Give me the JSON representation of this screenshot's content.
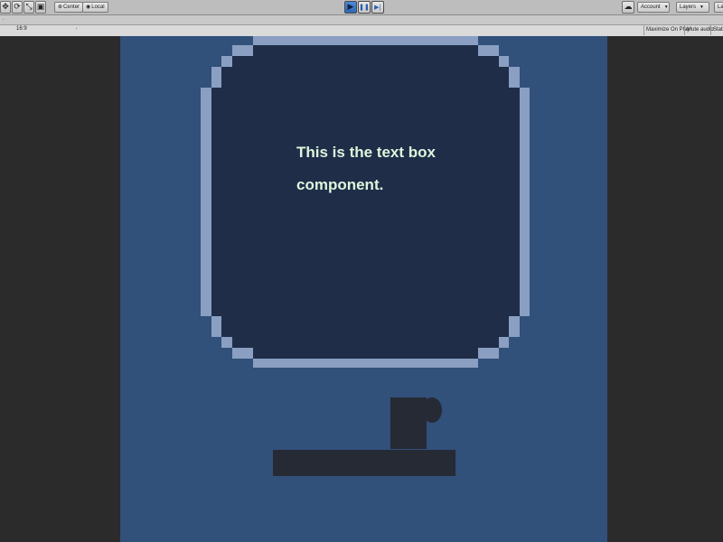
{
  "toolbar": {
    "transform_tools": [
      {
        "name": "move-tool",
        "glyph": "✥"
      },
      {
        "name": "rotate-tool",
        "glyph": "⟳"
      },
      {
        "name": "scale-tool",
        "glyph": "⤡"
      },
      {
        "name": "rect-tool",
        "glyph": "▣"
      }
    ],
    "pivot_label": "Center",
    "space_label": "Local",
    "playback": {
      "play": "▶",
      "pause": "❚❚",
      "step": "▶|"
    },
    "cloud_glyph": "☁",
    "account_label": "Account",
    "layers_label": "Layers",
    "layout_label": "La"
  },
  "game_view": {
    "display_ticks": ".",
    "aspect_label": "",
    "aspect_value": "16:9",
    "aspect_caret": "‹",
    "maximize_label": "Maximize On Play",
    "mute_label": "Mute audio",
    "stats_label": "Stats"
  },
  "scene": {
    "text_box": {
      "line1": "This is the text box",
      "line2": "component."
    }
  },
  "colors": {
    "scene_background": "#31507a",
    "panel_fill": "#1f2d48",
    "panel_border": "#8a9fc2",
    "text": "#dcf6dc",
    "dark_objects": "#262a35",
    "play_active": "#3a74c4"
  }
}
